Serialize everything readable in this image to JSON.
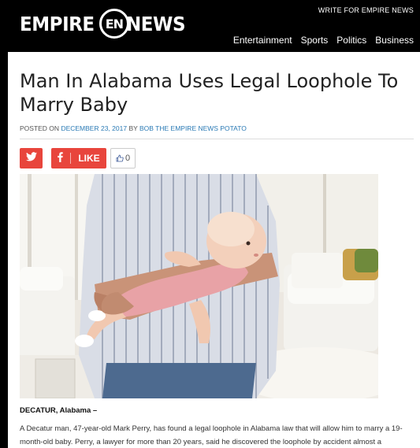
{
  "header": {
    "logo_left": "EMPIRE",
    "logo_mark": "EN",
    "logo_right": "NEWS",
    "write_link": "WRITE FOR EMPIRE NEWS",
    "nav": [
      "Entertainment",
      "Sports",
      "Politics",
      "Business"
    ]
  },
  "article": {
    "title": "Man In Alabama Uses Legal Loophole To Marry Baby",
    "posted_on": "POSTED ON",
    "date": "DECEMBER 23, 2017",
    "by": "BY",
    "author": "BOB THE EMPIRE NEWS POTATO",
    "dateline": "DECATUR, Alabama –",
    "body": "A Decatur man, 47-year-old Mark Perry, has found a legal loophole in Alabama law that will allow him to marry a 19-month-old baby. Perry, a lawyer for more than 20 years, said he discovered the loophole by accident almost a"
  },
  "share": {
    "twitter_icon": "twitter-icon",
    "facebook_icon": "facebook-icon",
    "like_label": "LIKE",
    "like_count": "0"
  },
  "colors": {
    "header_bg": "#000000",
    "share_red": "#e8453c",
    "link_blue": "#2a7ab5"
  }
}
